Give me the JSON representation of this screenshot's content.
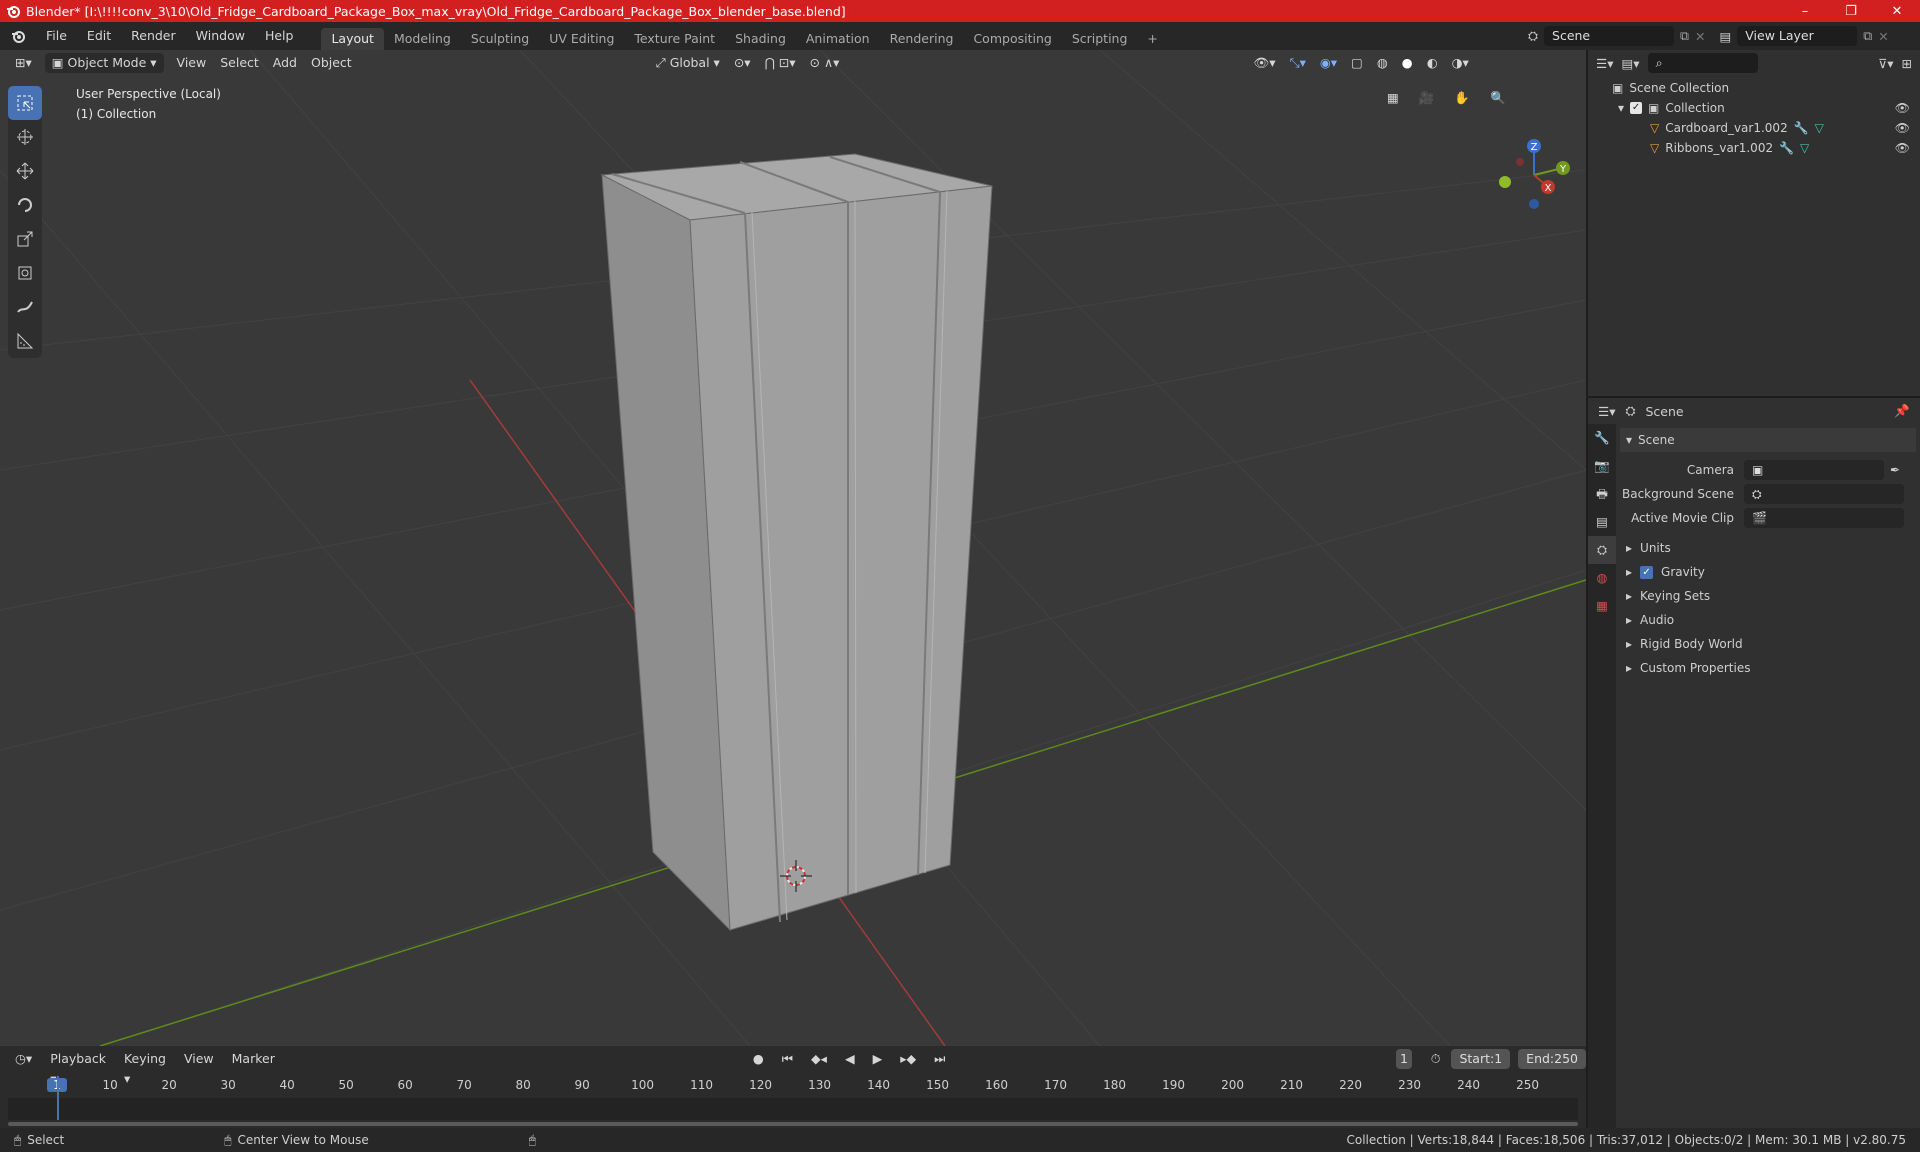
{
  "window": {
    "title": "Blender* [I:\\!!!!conv_3\\10\\Old_Fridge_Cardboard_Package_Box_max_vray\\Old_Fridge_Cardboard_Package_Box_blender_base.blend]",
    "minimize": "–",
    "maximize": "❐",
    "close": "✕"
  },
  "menu": [
    "File",
    "Edit",
    "Render",
    "Window",
    "Help"
  ],
  "workspaces": [
    "Layout",
    "Modeling",
    "Sculpting",
    "UV Editing",
    "Texture Paint",
    "Shading",
    "Animation",
    "Rendering",
    "Compositing",
    "Scripting"
  ],
  "workspace_add": "+",
  "scene_field": "Scene",
  "view_layer_field": "View Layer",
  "viewport": {
    "mode": "Object Mode",
    "menus": [
      "View",
      "Select",
      "Add",
      "Object"
    ],
    "orientation": "Global",
    "info_line1": "User Perspective (Local)",
    "info_line2": "(1) Collection",
    "gizmo_axes": {
      "x": "X",
      "y": "Y",
      "z": "Z"
    }
  },
  "outliner": {
    "root": "Scene Collection",
    "collection": "Collection",
    "items": [
      "Cardboard_var1.002",
      "Ribbons_var1.002"
    ]
  },
  "properties": {
    "context": "Scene",
    "panel": "Scene",
    "fields": {
      "camera": "Camera",
      "background_scene": "Background Scene",
      "active_movie_clip": "Active Movie Clip"
    },
    "sections": [
      "Units",
      "Gravity",
      "Keying Sets",
      "Audio",
      "Rigid Body World",
      "Custom Properties"
    ],
    "gravity_checked": true
  },
  "timeline": {
    "menus": [
      "Playback",
      "Keying",
      "View",
      "Marker"
    ],
    "current_frame": "1",
    "start_label": "Start:",
    "start": "1",
    "end_label": "End:",
    "end": "250",
    "ruler": [
      "1",
      "10",
      "20",
      "30",
      "40",
      "50",
      "60",
      "70",
      "80",
      "90",
      "100",
      "110",
      "120",
      "130",
      "140",
      "150",
      "160",
      "170",
      "180",
      "190",
      "200",
      "210",
      "220",
      "230",
      "240",
      "250"
    ]
  },
  "statusbar": {
    "select": "Select",
    "center": "Center View to Mouse",
    "stats": "Collection | Verts:18,844 | Faces:18,506 | Tris:37,012 | Objects:0/2 | Mem: 30.1 MB | v2.80.75"
  },
  "colors": {
    "titlebar": "#d21f1f",
    "active_tool": "#4772b3",
    "axis_x": "#c0392b",
    "axis_y": "#6f9a1f",
    "mesh_icon": "#e89a3c"
  }
}
